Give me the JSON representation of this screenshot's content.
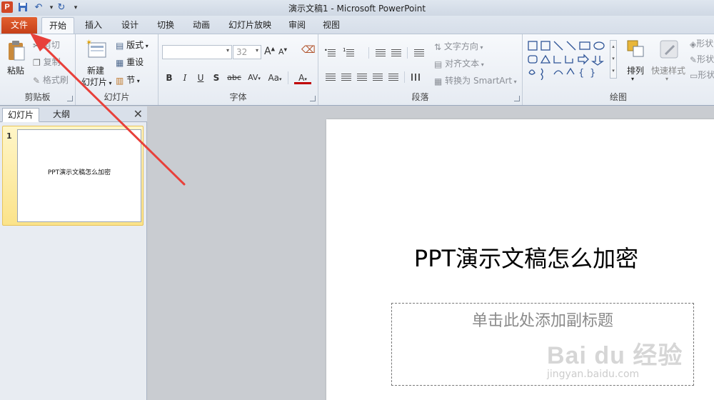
{
  "titlebar": {
    "title": "演示文稿1 - Microsoft PowerPoint",
    "app_icon": "P"
  },
  "tabs": {
    "file": "文件",
    "items": [
      "开始",
      "插入",
      "设计",
      "切换",
      "动画",
      "幻灯片放映",
      "审阅",
      "视图"
    ],
    "active": "开始"
  },
  "ribbon": {
    "clipboard": {
      "paste": "粘贴",
      "cut": "剪切",
      "copy": "复制",
      "format_painter": "格式刷",
      "label": "剪贴板"
    },
    "slides": {
      "new_slide_1": "新建",
      "new_slide_2": "幻灯片",
      "layout": "版式",
      "reset": "重设",
      "section": "节",
      "label": "幻灯片"
    },
    "font": {
      "size": "32",
      "bold": "B",
      "italic": "I",
      "underline": "U",
      "shadow": "S",
      "strike": "abc",
      "spacing": "AV",
      "case": "Aa",
      "grow": "A",
      "shrink": "A",
      "color": "A",
      "label": "字体"
    },
    "paragraph": {
      "text_direction": "文字方向",
      "align_text": "对齐文本",
      "convert_smartart": "转换为 SmartArt",
      "label": "段落"
    },
    "drawing": {
      "arrange": "排列",
      "quick_styles": "快速样式",
      "shape_fill": "形状",
      "shape_outline": "形状",
      "shape_effects": "形状",
      "label": "绘图"
    }
  },
  "left_pane": {
    "tabs": [
      "幻灯片",
      "大纲"
    ],
    "slide_number": "1",
    "thumb_title": "PPT演示文稿怎么加密"
  },
  "slide": {
    "title": "PPT演示文稿怎么加密",
    "subtitle_placeholder": "单击此处添加副标题"
  },
  "watermark": {
    "logo": "Bai du 经验",
    "url": "jingyan.baidu.com"
  },
  "colors": {
    "file_tab": "#d24726",
    "arrow": "#e8403a",
    "accent": "#2f5597"
  }
}
